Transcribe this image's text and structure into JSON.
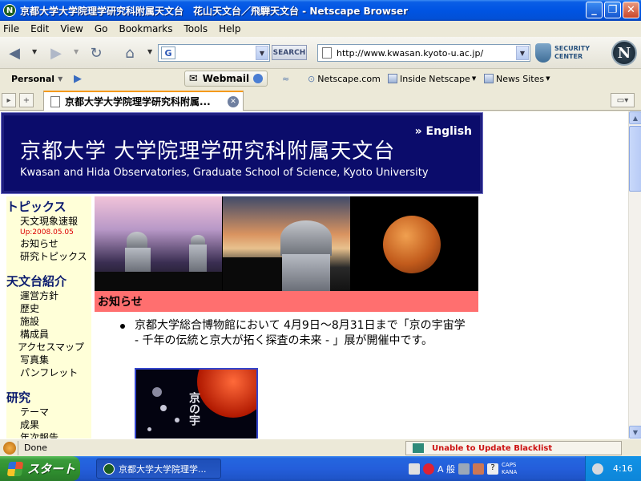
{
  "window": {
    "title": "京都大学大学院理学研究科附属天文台　花山天文台／飛騨天文台 - Netscape Browser"
  },
  "menu": [
    "File",
    "Edit",
    "View",
    "Go",
    "Bookmarks",
    "Tools",
    "Help"
  ],
  "toolbar": {
    "search_button": "SEARCH",
    "url": "http://www.kwasan.kyoto-u.ac.jp/",
    "security_center": "SECURITY CENTER"
  },
  "personal_toolbar": {
    "personal": "Personal",
    "webmail": "Webmail",
    "links": [
      "Netscape.com",
      "Inside Netscape",
      "News Sites"
    ]
  },
  "tab": {
    "title": "京都大学大学院理学研究科附属..."
  },
  "page": {
    "header_jp": "京都大学 大学院理学研究科附属天文台",
    "header_en": "Kwasan and Hida Observatories, Graduate School of Science, Kyoto University",
    "english_link": "English",
    "sidebar": {
      "topics_title": "トピックス",
      "topics_items": [
        "天文現象速報",
        "お知らせ",
        "研究トピックス"
      ],
      "update": "Up:2008.05.05",
      "intro_title": "天文台紹介",
      "intro_items": [
        "運営方針",
        "歴史",
        "施設",
        "構成員",
        "アクセスマップ",
        "写真集",
        "パンフレット"
      ],
      "research_title": "研究",
      "research_items": [
        "テーマ",
        "成果",
        "年次報告"
      ]
    },
    "news_title": "お知らせ",
    "news_item": "京都大学総合博物館において 4月9日〜8月31日まで「京の宇宙学 - 千年の伝統と京大が拓く探査の未来 - 」展が開催中です。",
    "poster_text": "京の宇"
  },
  "statusbar": {
    "status": "Done",
    "blacklist": "Unable to Update Blacklist"
  },
  "taskbar": {
    "start": "スタート",
    "task": "京都大学大学院理学...",
    "ime_mode": "A 般",
    "caps": "CAPS",
    "kana": "KANA",
    "clock": "4:16"
  }
}
